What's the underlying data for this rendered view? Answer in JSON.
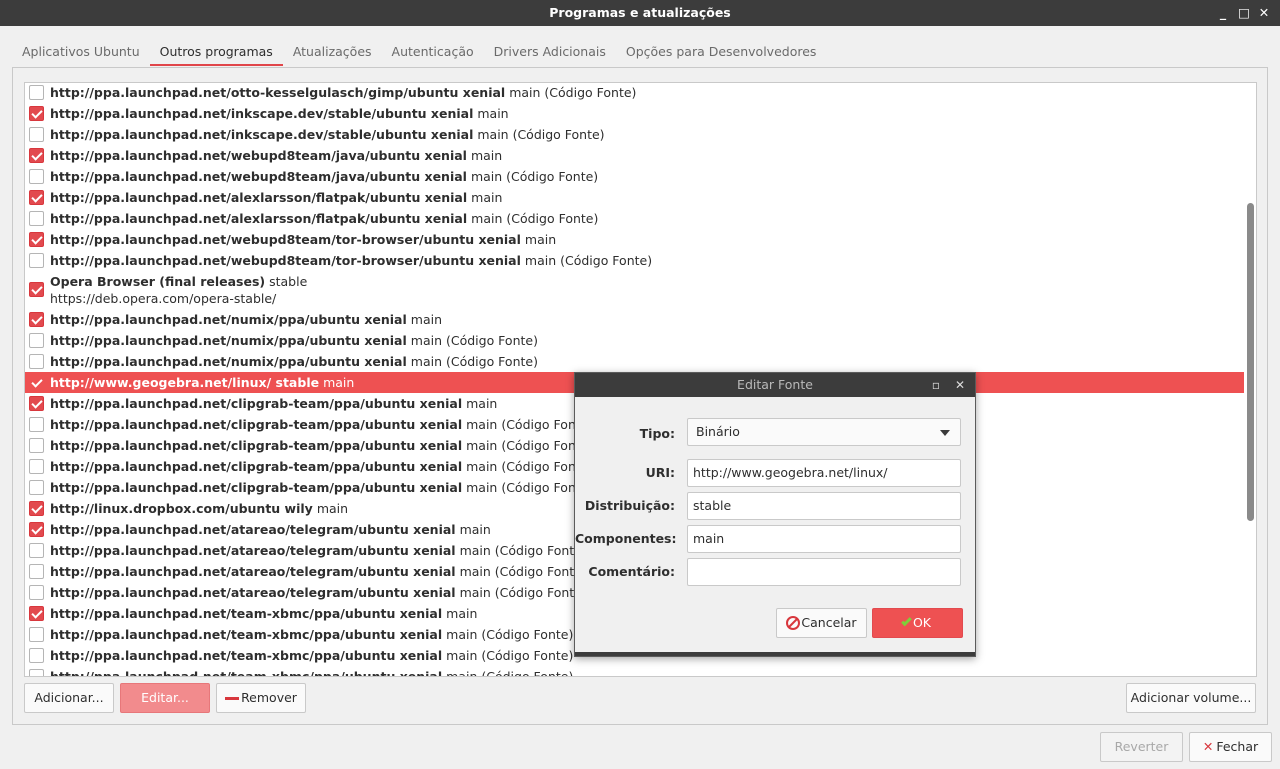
{
  "window": {
    "title": "Programas e atualizações",
    "min": "_",
    "max": "□",
    "close": "✕"
  },
  "tabs": [
    {
      "label": "Aplicativos Ubuntu",
      "active": false
    },
    {
      "label": "Outros programas",
      "active": true
    },
    {
      "label": "Atualizações",
      "active": false
    },
    {
      "label": "Autenticação",
      "active": false
    },
    {
      "label": "Drivers Adicionais",
      "active": false
    },
    {
      "label": "Opções para Desenvolvedores",
      "active": false
    }
  ],
  "sources": [
    {
      "checked": false,
      "url": "http://ppa.launchpad.net/otto-kesselgulasch/gimp/ubuntu xenial",
      "comp": "main (Código Fonte)"
    },
    {
      "checked": true,
      "url": "http://ppa.launchpad.net/inkscape.dev/stable/ubuntu xenial",
      "comp": "main"
    },
    {
      "checked": false,
      "url": "http://ppa.launchpad.net/inkscape.dev/stable/ubuntu xenial",
      "comp": "main (Código Fonte)"
    },
    {
      "checked": true,
      "url": "http://ppa.launchpad.net/webupd8team/java/ubuntu xenial",
      "comp": "main"
    },
    {
      "checked": false,
      "url": "http://ppa.launchpad.net/webupd8team/java/ubuntu xenial",
      "comp": "main (Código Fonte)"
    },
    {
      "checked": true,
      "url": "http://ppa.launchpad.net/alexlarsson/flatpak/ubuntu xenial",
      "comp": "main"
    },
    {
      "checked": false,
      "url": "http://ppa.launchpad.net/alexlarsson/flatpak/ubuntu xenial",
      "comp": "main (Código Fonte)"
    },
    {
      "checked": true,
      "url": "http://ppa.launchpad.net/webupd8team/tor-browser/ubuntu xenial",
      "comp": "main"
    },
    {
      "checked": false,
      "url": "http://ppa.launchpad.net/webupd8team/tor-browser/ubuntu xenial",
      "comp": "main (Código Fonte)"
    },
    {
      "checked": true,
      "url": "Opera Browser (final releases)",
      "comp": "stable",
      "sub": "https://deb.opera.com/opera-stable/"
    },
    {
      "checked": true,
      "url": "http://ppa.launchpad.net/numix/ppa/ubuntu xenial",
      "comp": "main"
    },
    {
      "checked": false,
      "url": "http://ppa.launchpad.net/numix/ppa/ubuntu xenial",
      "comp": "main (Código Fonte)"
    },
    {
      "checked": false,
      "url": "http://ppa.launchpad.net/numix/ppa/ubuntu xenial",
      "comp": "main (Código Fonte)"
    },
    {
      "checked": true,
      "url": "http://www.geogebra.net/linux/ stable",
      "comp": "main",
      "selected": true
    },
    {
      "checked": true,
      "url": "http://ppa.launchpad.net/clipgrab-team/ppa/ubuntu xenial",
      "comp": "main"
    },
    {
      "checked": false,
      "url": "http://ppa.launchpad.net/clipgrab-team/ppa/ubuntu xenial",
      "comp": "main (Código Fonte)"
    },
    {
      "checked": false,
      "url": "http://ppa.launchpad.net/clipgrab-team/ppa/ubuntu xenial",
      "comp": "main (Código Fonte)"
    },
    {
      "checked": false,
      "url": "http://ppa.launchpad.net/clipgrab-team/ppa/ubuntu xenial",
      "comp": "main (Código Fonte)"
    },
    {
      "checked": false,
      "url": "http://ppa.launchpad.net/clipgrab-team/ppa/ubuntu xenial",
      "comp": "main (Código Fonte)"
    },
    {
      "checked": true,
      "url": "http://linux.dropbox.com/ubuntu wily",
      "comp": "main"
    },
    {
      "checked": true,
      "url": "http://ppa.launchpad.net/atareao/telegram/ubuntu xenial",
      "comp": "main"
    },
    {
      "checked": false,
      "url": "http://ppa.launchpad.net/atareao/telegram/ubuntu xenial",
      "comp": "main (Código Fonte)"
    },
    {
      "checked": false,
      "url": "http://ppa.launchpad.net/atareao/telegram/ubuntu xenial",
      "comp": "main (Código Fonte)"
    },
    {
      "checked": false,
      "url": "http://ppa.launchpad.net/atareao/telegram/ubuntu xenial",
      "comp": "main (Código Fonte)"
    },
    {
      "checked": true,
      "url": "http://ppa.launchpad.net/team-xbmc/ppa/ubuntu xenial",
      "comp": "main"
    },
    {
      "checked": false,
      "url": "http://ppa.launchpad.net/team-xbmc/ppa/ubuntu xenial",
      "comp": "main (Código Fonte)"
    },
    {
      "checked": false,
      "url": "http://ppa.launchpad.net/team-xbmc/ppa/ubuntu xenial",
      "comp": "main (Código Fonte)"
    },
    {
      "checked": false,
      "url": "http://ppa.launchpad.net/team-xbmc/ppa/ubuntu xenial",
      "comp": "main (Código Fonte)"
    }
  ],
  "list_buttons": {
    "add": "Adicionar...",
    "edit": "Editar...",
    "remove": "Remover",
    "add_volume": "Adicionar volume..."
  },
  "footer": {
    "revert": "Reverter",
    "close": "Fechar"
  },
  "dialog": {
    "title": "Editar Fonte",
    "type_label": "Tipo:",
    "type_value": "Binário",
    "uri_label": "URI:",
    "uri_value": "http://www.geogebra.net/linux/",
    "dist_label": "Distribuição:",
    "dist_value": "stable",
    "comp_label": "Componentes:",
    "comp_value": "main",
    "comment_label": "Comentário:",
    "comment_value": "",
    "cancel": "Cancelar",
    "ok": "OK"
  },
  "colors": {
    "accent": "#e24a4f",
    "selection": "#ee5152",
    "titlebar": "#3c3c3c"
  }
}
